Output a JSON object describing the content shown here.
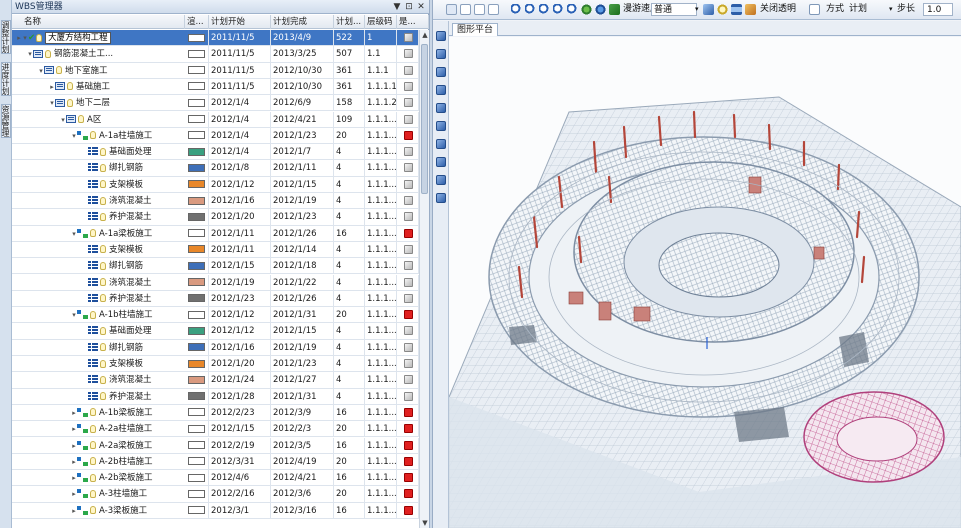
{
  "panel": {
    "title": "WBS管理器",
    "pin_glyph": "▼",
    "pin2_glyph": "⊡",
    "close_glyph": "✕"
  },
  "side_tabs": [
    "调整计划",
    "进度计划",
    "资源管理"
  ],
  "columns": {
    "name": "名称",
    "color": "渲...",
    "start": "计划开始",
    "end": "计划完成",
    "duration": "计划...",
    "code": "层级码",
    "visible": "是..."
  },
  "rows": [
    {
      "name": "大厦方结构工程",
      "start": "2011/11/5",
      "end": "2013/4/9",
      "dur": "522",
      "code": "1",
      "swatch": "#ffffff",
      "vis": "grey",
      "indent": 0,
      "kind": "root",
      "toggle": "▾",
      "selected": true
    },
    {
      "name": "钢筋混凝土工...",
      "start": "2011/11/5",
      "end": "2013/3/25",
      "dur": "507",
      "code": "1.1",
      "swatch": "#ffffff",
      "vis": "grey",
      "indent": 1,
      "kind": "wbs",
      "toggle": "▾"
    },
    {
      "name": "地下室施工",
      "start": "2011/11/5",
      "end": "2012/10/30",
      "dur": "361",
      "code": "1.1.1",
      "swatch": "#ffffff",
      "vis": "grey",
      "indent": 2,
      "kind": "wbs",
      "toggle": "▾"
    },
    {
      "name": "基础施工",
      "start": "2011/11/5",
      "end": "2012/10/30",
      "dur": "361",
      "code": "1.1.1.1",
      "swatch": "#ffffff",
      "vis": "grey",
      "indent": 3,
      "kind": "wbs",
      "toggle": "▸"
    },
    {
      "name": "地下二层",
      "start": "2012/1/4",
      "end": "2012/6/9",
      "dur": "158",
      "code": "1.1.1.2",
      "swatch": "#ffffff",
      "vis": "grey",
      "indent": 3,
      "kind": "wbs",
      "toggle": "▾"
    },
    {
      "name": "A区",
      "start": "2012/1/4",
      "end": "2012/4/21",
      "dur": "109",
      "code": "1.1.1...",
      "swatch": "#ffffff",
      "vis": "grey",
      "indent": 4,
      "kind": "wbs",
      "toggle": "▾"
    },
    {
      "name": "A-1a柱墙施工",
      "start": "2012/1/4",
      "end": "2012/1/23",
      "dur": "20",
      "code": "1.1.1...",
      "swatch": "#ffffff",
      "vis": "red",
      "indent": 5,
      "kind": "group",
      "toggle": "▾"
    },
    {
      "name": "基础面处理",
      "start": "2012/1/4",
      "end": "2012/1/7",
      "dur": "4",
      "code": "1.1.1...",
      "swatch": "#3aa080",
      "vis": "grey",
      "indent": 6,
      "kind": "task",
      "toggle": ""
    },
    {
      "name": "绑扎钢筋",
      "start": "2012/1/8",
      "end": "2012/1/11",
      "dur": "4",
      "code": "1.1.1...",
      "swatch": "#3e6fb8",
      "vis": "grey",
      "indent": 6,
      "kind": "task",
      "toggle": ""
    },
    {
      "name": "支架模板",
      "start": "2012/1/12",
      "end": "2012/1/15",
      "dur": "4",
      "code": "1.1.1...",
      "swatch": "#e8872a",
      "vis": "grey",
      "indent": 6,
      "kind": "task",
      "toggle": ""
    },
    {
      "name": "浇筑混凝土",
      "start": "2012/1/16",
      "end": "2012/1/19",
      "dur": "4",
      "code": "1.1.1...",
      "swatch": "#d99a80",
      "vis": "grey",
      "indent": 6,
      "kind": "task",
      "toggle": ""
    },
    {
      "name": "养护混凝土",
      "start": "2012/1/20",
      "end": "2012/1/23",
      "dur": "4",
      "code": "1.1.1...",
      "swatch": "#707070",
      "vis": "grey",
      "indent": 6,
      "kind": "task",
      "toggle": ""
    },
    {
      "name": "A-1a梁板施工",
      "start": "2012/1/11",
      "end": "2012/1/26",
      "dur": "16",
      "code": "1.1.1...",
      "swatch": "#ffffff",
      "vis": "red",
      "indent": 5,
      "kind": "group",
      "toggle": "▾"
    },
    {
      "name": "支架模板",
      "start": "2012/1/11",
      "end": "2012/1/14",
      "dur": "4",
      "code": "1.1.1...",
      "swatch": "#e8872a",
      "vis": "grey",
      "indent": 6,
      "kind": "task",
      "toggle": ""
    },
    {
      "name": "绑扎钢筋",
      "start": "2012/1/15",
      "end": "2012/1/18",
      "dur": "4",
      "code": "1.1.1...",
      "swatch": "#3e6fb8",
      "vis": "grey",
      "indent": 6,
      "kind": "task",
      "toggle": ""
    },
    {
      "name": "浇筑混凝土",
      "start": "2012/1/19",
      "end": "2012/1/22",
      "dur": "4",
      "code": "1.1.1...",
      "swatch": "#d99a80",
      "vis": "grey",
      "indent": 6,
      "kind": "task",
      "toggle": ""
    },
    {
      "name": "养护混凝土",
      "start": "2012/1/23",
      "end": "2012/1/26",
      "dur": "4",
      "code": "1.1.1...",
      "swatch": "#707070",
      "vis": "grey",
      "indent": 6,
      "kind": "task",
      "toggle": ""
    },
    {
      "name": "A-1b柱墙施工",
      "start": "2012/1/12",
      "end": "2012/1/31",
      "dur": "20",
      "code": "1.1.1...",
      "swatch": "#ffffff",
      "vis": "red",
      "indent": 5,
      "kind": "group",
      "toggle": "▾"
    },
    {
      "name": "基础面处理",
      "start": "2012/1/12",
      "end": "2012/1/15",
      "dur": "4",
      "code": "1.1.1...",
      "swatch": "#3aa080",
      "vis": "grey",
      "indent": 6,
      "kind": "task",
      "toggle": ""
    },
    {
      "name": "绑扎钢筋",
      "start": "2012/1/16",
      "end": "2012/1/19",
      "dur": "4",
      "code": "1.1.1...",
      "swatch": "#3e6fb8",
      "vis": "grey",
      "indent": 6,
      "kind": "task",
      "toggle": ""
    },
    {
      "name": "支架模板",
      "start": "2012/1/20",
      "end": "2012/1/23",
      "dur": "4",
      "code": "1.1.1...",
      "swatch": "#e8872a",
      "vis": "grey",
      "indent": 6,
      "kind": "task",
      "toggle": ""
    },
    {
      "name": "浇筑混凝土",
      "start": "2012/1/24",
      "end": "2012/1/27",
      "dur": "4",
      "code": "1.1.1...",
      "swatch": "#d99a80",
      "vis": "grey",
      "indent": 6,
      "kind": "task",
      "toggle": ""
    },
    {
      "name": "养护混凝土",
      "start": "2012/1/28",
      "end": "2012/1/31",
      "dur": "4",
      "code": "1.1.1...",
      "swatch": "#707070",
      "vis": "grey",
      "indent": 6,
      "kind": "task",
      "toggle": ""
    },
    {
      "name": "A-1b梁板施工",
      "start": "2012/2/23",
      "end": "2012/3/9",
      "dur": "16",
      "code": "1.1.1...",
      "swatch": "#ffffff",
      "vis": "red",
      "indent": 5,
      "kind": "group",
      "toggle": "▸"
    },
    {
      "name": "A-2a柱墙施工",
      "start": "2012/1/15",
      "end": "2012/2/3",
      "dur": "20",
      "code": "1.1.1...",
      "swatch": "#ffffff",
      "vis": "red",
      "indent": 5,
      "kind": "group",
      "toggle": "▸"
    },
    {
      "name": "A-2a梁板施工",
      "start": "2012/2/19",
      "end": "2012/3/5",
      "dur": "16",
      "code": "1.1.1...",
      "swatch": "#ffffff",
      "vis": "red",
      "indent": 5,
      "kind": "group",
      "toggle": "▸"
    },
    {
      "name": "A-2b柱墙施工",
      "start": "2012/3/31",
      "end": "2012/4/19",
      "dur": "20",
      "code": "1.1.1...",
      "swatch": "#ffffff",
      "vis": "red",
      "indent": 5,
      "kind": "group",
      "toggle": "▸"
    },
    {
      "name": "A-2b梁板施工",
      "start": "2012/4/6",
      "end": "2012/4/21",
      "dur": "16",
      "code": "1.1.1...",
      "swatch": "#ffffff",
      "vis": "red",
      "indent": 5,
      "kind": "group",
      "toggle": "▸"
    },
    {
      "name": "A-3柱墙施工",
      "start": "2012/2/16",
      "end": "2012/3/6",
      "dur": "20",
      "code": "1.1.1...",
      "swatch": "#ffffff",
      "vis": "red",
      "indent": 5,
      "kind": "group",
      "toggle": "▸"
    },
    {
      "name": "A-3梁板施工",
      "start": "2012/3/1",
      "end": "2012/3/16",
      "dur": "16",
      "code": "1.1.1...",
      "swatch": "#ffffff",
      "vis": "red",
      "indent": 5,
      "kind": "group",
      "toggle": "▸"
    }
  ],
  "toolbar": {
    "speed_label": "漫游速度",
    "speed_value": "普通",
    "close_transparent": "关闭透明",
    "mode_label": "方式",
    "mode_value": "计划",
    "step_label": "步长",
    "step_value": "1.0"
  },
  "view_tab": "图形平台",
  "colors": {
    "selected_row": "#3f76c4",
    "accent": "#2c5aa0",
    "red_visible": "#e02020"
  }
}
